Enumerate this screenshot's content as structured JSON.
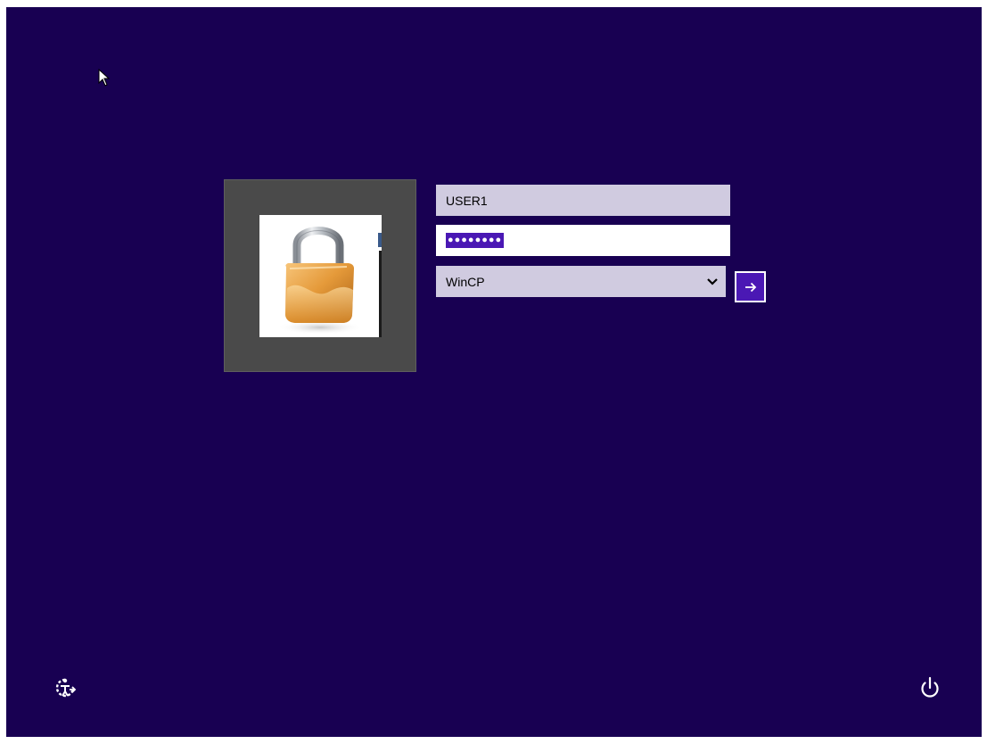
{
  "login": {
    "username": "USER1",
    "password_mask": "●●●●●●●●",
    "domain": "WinCP"
  },
  "icons": {
    "user_tile": "padlock-icon",
    "domain_dropdown": "chevron-down-icon",
    "submit": "arrow-right-icon",
    "ease_of_access": "ease-of-access-icon",
    "power": "power-icon",
    "cursor": "mouse-pointer-icon"
  },
  "colors": {
    "background": "#180052",
    "accent": "#4a18b4",
    "field_fill": "#d0cbe0",
    "tile": "#4a4a4a"
  }
}
